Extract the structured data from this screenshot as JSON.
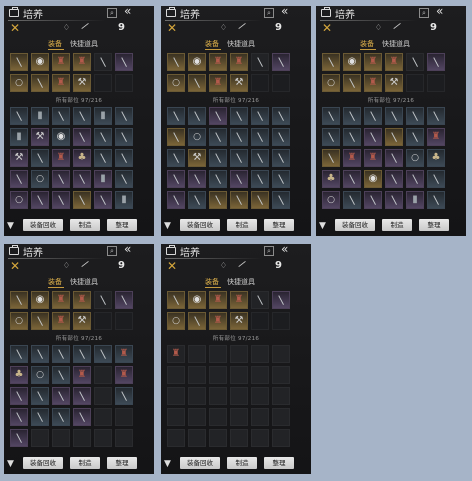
{
  "title": "培养",
  "search_icon": "⌕",
  "back_icon": "«",
  "count_label": "9",
  "tabs": [
    "装备",
    "快捷道具"
  ],
  "owned_label": "所有部位 97/216",
  "buttons": {
    "recycle": "装备回收",
    "craft": "制造",
    "sort": "整理"
  },
  "colors": {
    "gold": "#7b6538",
    "purple": "#534663",
    "blue": "#3d4a56",
    "accent": "#e0b34c"
  },
  "panels": [
    {
      "top": [
        {
          "c": "gold",
          "i": "weapon"
        },
        {
          "c": "gold",
          "i": "shield"
        },
        {
          "c": "gold",
          "i": "armor"
        },
        {
          "c": "gold",
          "i": "armor"
        },
        {
          "c": "dark",
          "i": "weapon"
        },
        {
          "c": "purple",
          "i": "weapon"
        },
        {
          "c": "gold",
          "i": "ring"
        },
        {
          "c": "gold",
          "i": "weapon"
        },
        {
          "c": "gold",
          "i": "armor"
        },
        {
          "c": "gold",
          "i": "axe"
        },
        {
          "c": "empty",
          "i": ""
        },
        {
          "c": "empty",
          "i": ""
        }
      ],
      "inv": [
        {
          "c": "blue",
          "i": "weapon"
        },
        {
          "c": "blue",
          "i": "boots"
        },
        {
          "c": "blue",
          "i": "weapon"
        },
        {
          "c": "blue",
          "i": "weapon"
        },
        {
          "c": "blue",
          "i": "boots"
        },
        {
          "c": "blue",
          "i": "weapon"
        },
        {
          "c": "blue",
          "i": "boots"
        },
        {
          "c": "purple",
          "i": "axe"
        },
        {
          "c": "blue",
          "i": "shield"
        },
        {
          "c": "purple",
          "i": "weapon"
        },
        {
          "c": "blue",
          "i": "weapon"
        },
        {
          "c": "blue",
          "i": "weapon"
        },
        {
          "c": "purple",
          "i": "axe"
        },
        {
          "c": "blue",
          "i": "weapon"
        },
        {
          "c": "purple",
          "i": "armor"
        },
        {
          "c": "purple",
          "i": "sack"
        },
        {
          "c": "blue",
          "i": "weapon"
        },
        {
          "c": "blue",
          "i": "weapon"
        },
        {
          "c": "purple",
          "i": "weapon"
        },
        {
          "c": "blue",
          "i": "ring"
        },
        {
          "c": "purple",
          "i": "weapon"
        },
        {
          "c": "purple",
          "i": "weapon"
        },
        {
          "c": "purple",
          "i": "boots"
        },
        {
          "c": "blue",
          "i": "weapon"
        },
        {
          "c": "purple",
          "i": "ring"
        },
        {
          "c": "purple",
          "i": "weapon"
        },
        {
          "c": "purple",
          "i": "weapon"
        },
        {
          "c": "gold",
          "i": "weapon"
        },
        {
          "c": "purple",
          "i": "weapon"
        },
        {
          "c": "blue",
          "i": "boots"
        }
      ]
    },
    {
      "top": [
        {
          "c": "gold",
          "i": "weapon"
        },
        {
          "c": "gold",
          "i": "shield"
        },
        {
          "c": "gold",
          "i": "armor"
        },
        {
          "c": "gold",
          "i": "armor"
        },
        {
          "c": "dark",
          "i": "weapon"
        },
        {
          "c": "purple",
          "i": "weapon"
        },
        {
          "c": "gold",
          "i": "ring"
        },
        {
          "c": "gold",
          "i": "weapon"
        },
        {
          "c": "gold",
          "i": "armor"
        },
        {
          "c": "gold",
          "i": "axe"
        },
        {
          "c": "empty",
          "i": ""
        },
        {
          "c": "empty",
          "i": ""
        }
      ],
      "inv": [
        {
          "c": "blue",
          "i": "weapon"
        },
        {
          "c": "blue",
          "i": "weapon"
        },
        {
          "c": "purple",
          "i": "weapon"
        },
        {
          "c": "blue",
          "i": "weapon"
        },
        {
          "c": "blue",
          "i": "weapon"
        },
        {
          "c": "blue",
          "i": "weapon"
        },
        {
          "c": "gold",
          "i": "weapon"
        },
        {
          "c": "blue",
          "i": "ring"
        },
        {
          "c": "blue",
          "i": "weapon"
        },
        {
          "c": "blue",
          "i": "weapon"
        },
        {
          "c": "blue",
          "i": "weapon"
        },
        {
          "c": "blue",
          "i": "weapon"
        },
        {
          "c": "blue",
          "i": "weapon"
        },
        {
          "c": "gold",
          "i": "axe"
        },
        {
          "c": "blue",
          "i": "weapon"
        },
        {
          "c": "blue",
          "i": "weapon"
        },
        {
          "c": "blue",
          "i": "weapon"
        },
        {
          "c": "blue",
          "i": "weapon"
        },
        {
          "c": "purple",
          "i": "weapon"
        },
        {
          "c": "purple",
          "i": "weapon"
        },
        {
          "c": "blue",
          "i": "weapon"
        },
        {
          "c": "purple",
          "i": "weapon"
        },
        {
          "c": "blue",
          "i": "weapon"
        },
        {
          "c": "blue",
          "i": "weapon"
        },
        {
          "c": "purple",
          "i": "weapon"
        },
        {
          "c": "blue",
          "i": "weapon"
        },
        {
          "c": "gold",
          "i": "weapon"
        },
        {
          "c": "gold",
          "i": "weapon"
        },
        {
          "c": "gold",
          "i": "weapon"
        },
        {
          "c": "blue",
          "i": "weapon"
        }
      ]
    },
    {
      "top": [
        {
          "c": "gold",
          "i": "weapon"
        },
        {
          "c": "gold",
          "i": "shield"
        },
        {
          "c": "gold",
          "i": "armor"
        },
        {
          "c": "gold",
          "i": "armor"
        },
        {
          "c": "dark",
          "i": "weapon"
        },
        {
          "c": "purple",
          "i": "weapon"
        },
        {
          "c": "gold",
          "i": "ring"
        },
        {
          "c": "gold",
          "i": "weapon"
        },
        {
          "c": "gold",
          "i": "armor"
        },
        {
          "c": "gold",
          "i": "axe"
        },
        {
          "c": "empty",
          "i": ""
        },
        {
          "c": "empty",
          "i": ""
        }
      ],
      "inv": [
        {
          "c": "blue",
          "i": "weapon"
        },
        {
          "c": "blue",
          "i": "weapon"
        },
        {
          "c": "blue",
          "i": "weapon"
        },
        {
          "c": "blue",
          "i": "weapon"
        },
        {
          "c": "blue",
          "i": "weapon"
        },
        {
          "c": "blue",
          "i": "weapon"
        },
        {
          "c": "blue",
          "i": "weapon"
        },
        {
          "c": "blue",
          "i": "weapon"
        },
        {
          "c": "purple",
          "i": "weapon"
        },
        {
          "c": "gold",
          "i": "weapon"
        },
        {
          "c": "blue",
          "i": "weapon"
        },
        {
          "c": "purple",
          "i": "armor"
        },
        {
          "c": "gold",
          "i": "weapon"
        },
        {
          "c": "purple",
          "i": "armor"
        },
        {
          "c": "purple",
          "i": "armor"
        },
        {
          "c": "purple",
          "i": "weapon"
        },
        {
          "c": "blue",
          "i": "ring"
        },
        {
          "c": "blue",
          "i": "sack"
        },
        {
          "c": "purple",
          "i": "sack"
        },
        {
          "c": "purple",
          "i": "weapon"
        },
        {
          "c": "gold",
          "i": "shield"
        },
        {
          "c": "purple",
          "i": "weapon"
        },
        {
          "c": "purple",
          "i": "weapon"
        },
        {
          "c": "blue",
          "i": "weapon"
        },
        {
          "c": "purple",
          "i": "ring"
        },
        {
          "c": "blue",
          "i": "weapon"
        },
        {
          "c": "purple",
          "i": "weapon"
        },
        {
          "c": "purple",
          "i": "weapon"
        },
        {
          "c": "purple",
          "i": "boots"
        },
        {
          "c": "blue",
          "i": "weapon"
        }
      ]
    },
    {
      "top": [
        {
          "c": "gold",
          "i": "weapon"
        },
        {
          "c": "gold",
          "i": "shield"
        },
        {
          "c": "gold",
          "i": "armor"
        },
        {
          "c": "gold",
          "i": "armor"
        },
        {
          "c": "dark",
          "i": "weapon"
        },
        {
          "c": "purple",
          "i": "weapon"
        },
        {
          "c": "gold",
          "i": "ring"
        },
        {
          "c": "gold",
          "i": "weapon"
        },
        {
          "c": "gold",
          "i": "armor"
        },
        {
          "c": "gold",
          "i": "axe"
        },
        {
          "c": "empty",
          "i": ""
        },
        {
          "c": "empty",
          "i": ""
        }
      ],
      "inv": [
        {
          "c": "blue",
          "i": "weapon"
        },
        {
          "c": "blue",
          "i": "weapon"
        },
        {
          "c": "blue",
          "i": "weapon"
        },
        {
          "c": "blue",
          "i": "weapon"
        },
        {
          "c": "blue",
          "i": "weapon"
        },
        {
          "c": "blue",
          "i": "armor"
        },
        {
          "c": "purple",
          "i": "sack"
        },
        {
          "c": "blue",
          "i": "ring"
        },
        {
          "c": "blue",
          "i": "weapon"
        },
        {
          "c": "purple",
          "i": "armor"
        },
        {
          "c": "dark",
          "i": ""
        },
        {
          "c": "purple",
          "i": "armor"
        },
        {
          "c": "purple",
          "i": "weapon"
        },
        {
          "c": "blue",
          "i": "weapon"
        },
        {
          "c": "purple",
          "i": "weapon"
        },
        {
          "c": "purple",
          "i": "weapon"
        },
        {
          "c": "dark",
          "i": ""
        },
        {
          "c": "blue",
          "i": "weapon"
        },
        {
          "c": "purple",
          "i": "weapon"
        },
        {
          "c": "blue",
          "i": "weapon"
        },
        {
          "c": "blue",
          "i": "weapon"
        },
        {
          "c": "purple",
          "i": "weapon"
        },
        {
          "c": "dark",
          "i": ""
        },
        {
          "c": "dark",
          "i": ""
        },
        {
          "c": "purple",
          "i": "weapon"
        },
        {
          "c": "dark",
          "i": ""
        },
        {
          "c": "dark",
          "i": ""
        },
        {
          "c": "dark",
          "i": ""
        },
        {
          "c": "dark",
          "i": ""
        },
        {
          "c": "dark",
          "i": ""
        }
      ]
    },
    {
      "top": [
        {
          "c": "gold",
          "i": "weapon"
        },
        {
          "c": "gold",
          "i": "shield"
        },
        {
          "c": "gold",
          "i": "armor"
        },
        {
          "c": "gold",
          "i": "armor"
        },
        {
          "c": "dark",
          "i": "weapon"
        },
        {
          "c": "purple",
          "i": "weapon"
        },
        {
          "c": "gold",
          "i": "ring"
        },
        {
          "c": "gold",
          "i": "weapon"
        },
        {
          "c": "gold",
          "i": "armor"
        },
        {
          "c": "gold",
          "i": "axe"
        },
        {
          "c": "empty",
          "i": ""
        },
        {
          "c": "empty",
          "i": ""
        }
      ],
      "inv": [
        {
          "c": "dark",
          "i": "armor"
        },
        {
          "c": "dark",
          "i": ""
        },
        {
          "c": "dark",
          "i": ""
        },
        {
          "c": "dark",
          "i": ""
        },
        {
          "c": "dark",
          "i": ""
        },
        {
          "c": "dark",
          "i": ""
        },
        {
          "c": "dark",
          "i": ""
        },
        {
          "c": "dark",
          "i": ""
        },
        {
          "c": "dark",
          "i": ""
        },
        {
          "c": "dark",
          "i": ""
        },
        {
          "c": "dark",
          "i": ""
        },
        {
          "c": "dark",
          "i": ""
        },
        {
          "c": "dark",
          "i": ""
        },
        {
          "c": "dark",
          "i": ""
        },
        {
          "c": "dark",
          "i": ""
        },
        {
          "c": "dark",
          "i": ""
        },
        {
          "c": "dark",
          "i": ""
        },
        {
          "c": "dark",
          "i": ""
        },
        {
          "c": "dark",
          "i": ""
        },
        {
          "c": "dark",
          "i": ""
        },
        {
          "c": "dark",
          "i": ""
        },
        {
          "c": "dark",
          "i": ""
        },
        {
          "c": "dark",
          "i": ""
        },
        {
          "c": "dark",
          "i": ""
        },
        {
          "c": "dark",
          "i": ""
        },
        {
          "c": "dark",
          "i": ""
        },
        {
          "c": "dark",
          "i": ""
        },
        {
          "c": "dark",
          "i": ""
        },
        {
          "c": "dark",
          "i": ""
        },
        {
          "c": "dark",
          "i": ""
        }
      ]
    }
  ]
}
